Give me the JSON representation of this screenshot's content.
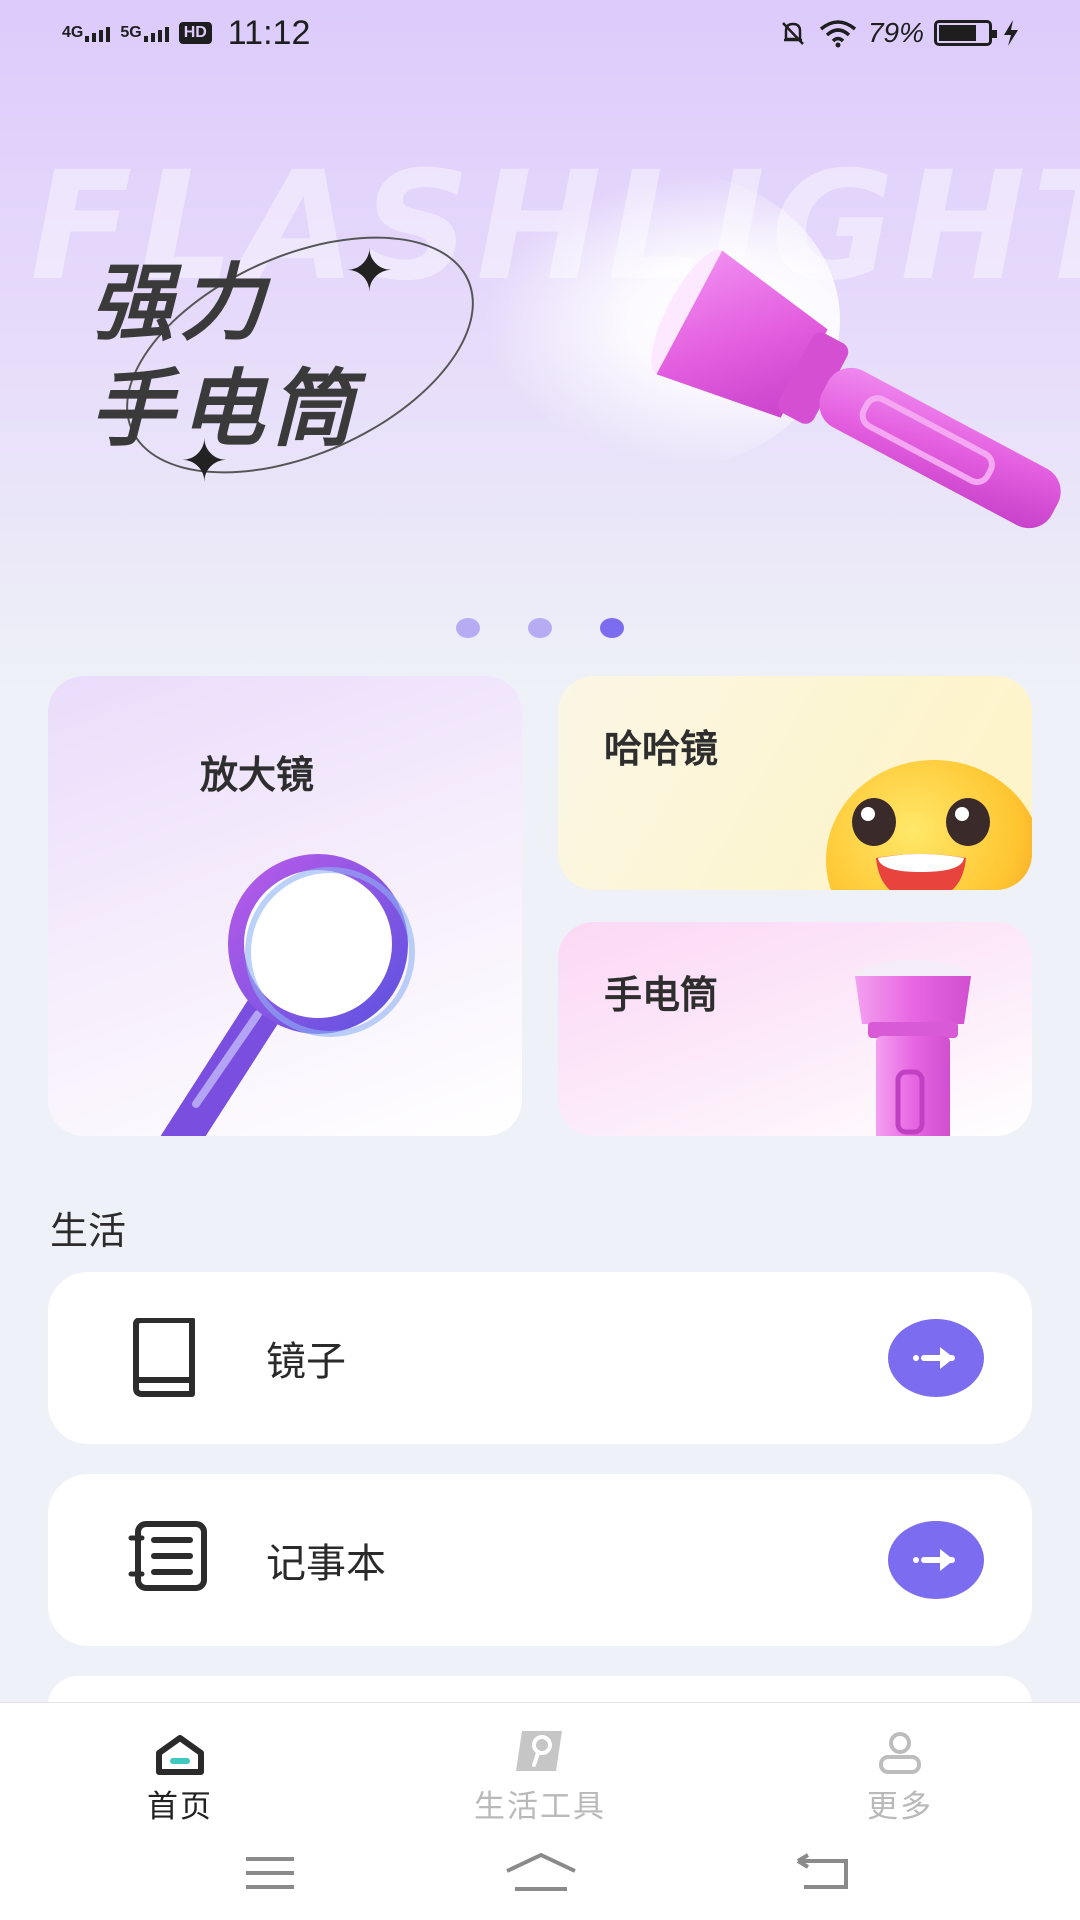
{
  "status_bar": {
    "network_1": "4G",
    "network_2": "5G",
    "hd": "HD",
    "time": "11:12",
    "battery_percent": "79%",
    "battery_level": 0.79
  },
  "banner": {
    "watermark": "FLASHLIGHT",
    "title_line1": "强力",
    "title_line2": "手电筒",
    "pages": 3,
    "active_page": 3
  },
  "features": {
    "magnifier": {
      "label": "放大镜",
      "icon": "magnifier-icon"
    },
    "funhouse_mirror": {
      "label": "哈哈镜",
      "icon": "emoji-face-icon"
    },
    "flashlight": {
      "label": "手电筒",
      "icon": "flashlight-icon"
    }
  },
  "section": {
    "title": "生活",
    "items": [
      {
        "label": "镜子",
        "icon": "book-icon"
      },
      {
        "label": "记事本",
        "icon": "notebook-icon"
      }
    ]
  },
  "bottom_nav": {
    "tabs": [
      {
        "label": "首页",
        "icon": "home-icon",
        "active": true
      },
      {
        "label": "生活工具",
        "icon": "tools-icon",
        "active": false
      },
      {
        "label": "更多",
        "icon": "user-icon",
        "active": false
      }
    ]
  },
  "colors": {
    "accent": "#7b6cf0",
    "banner_bg": "#dccbfb",
    "page_bg": "#eef1f7",
    "flashlight_pink": "#e85ee0"
  }
}
